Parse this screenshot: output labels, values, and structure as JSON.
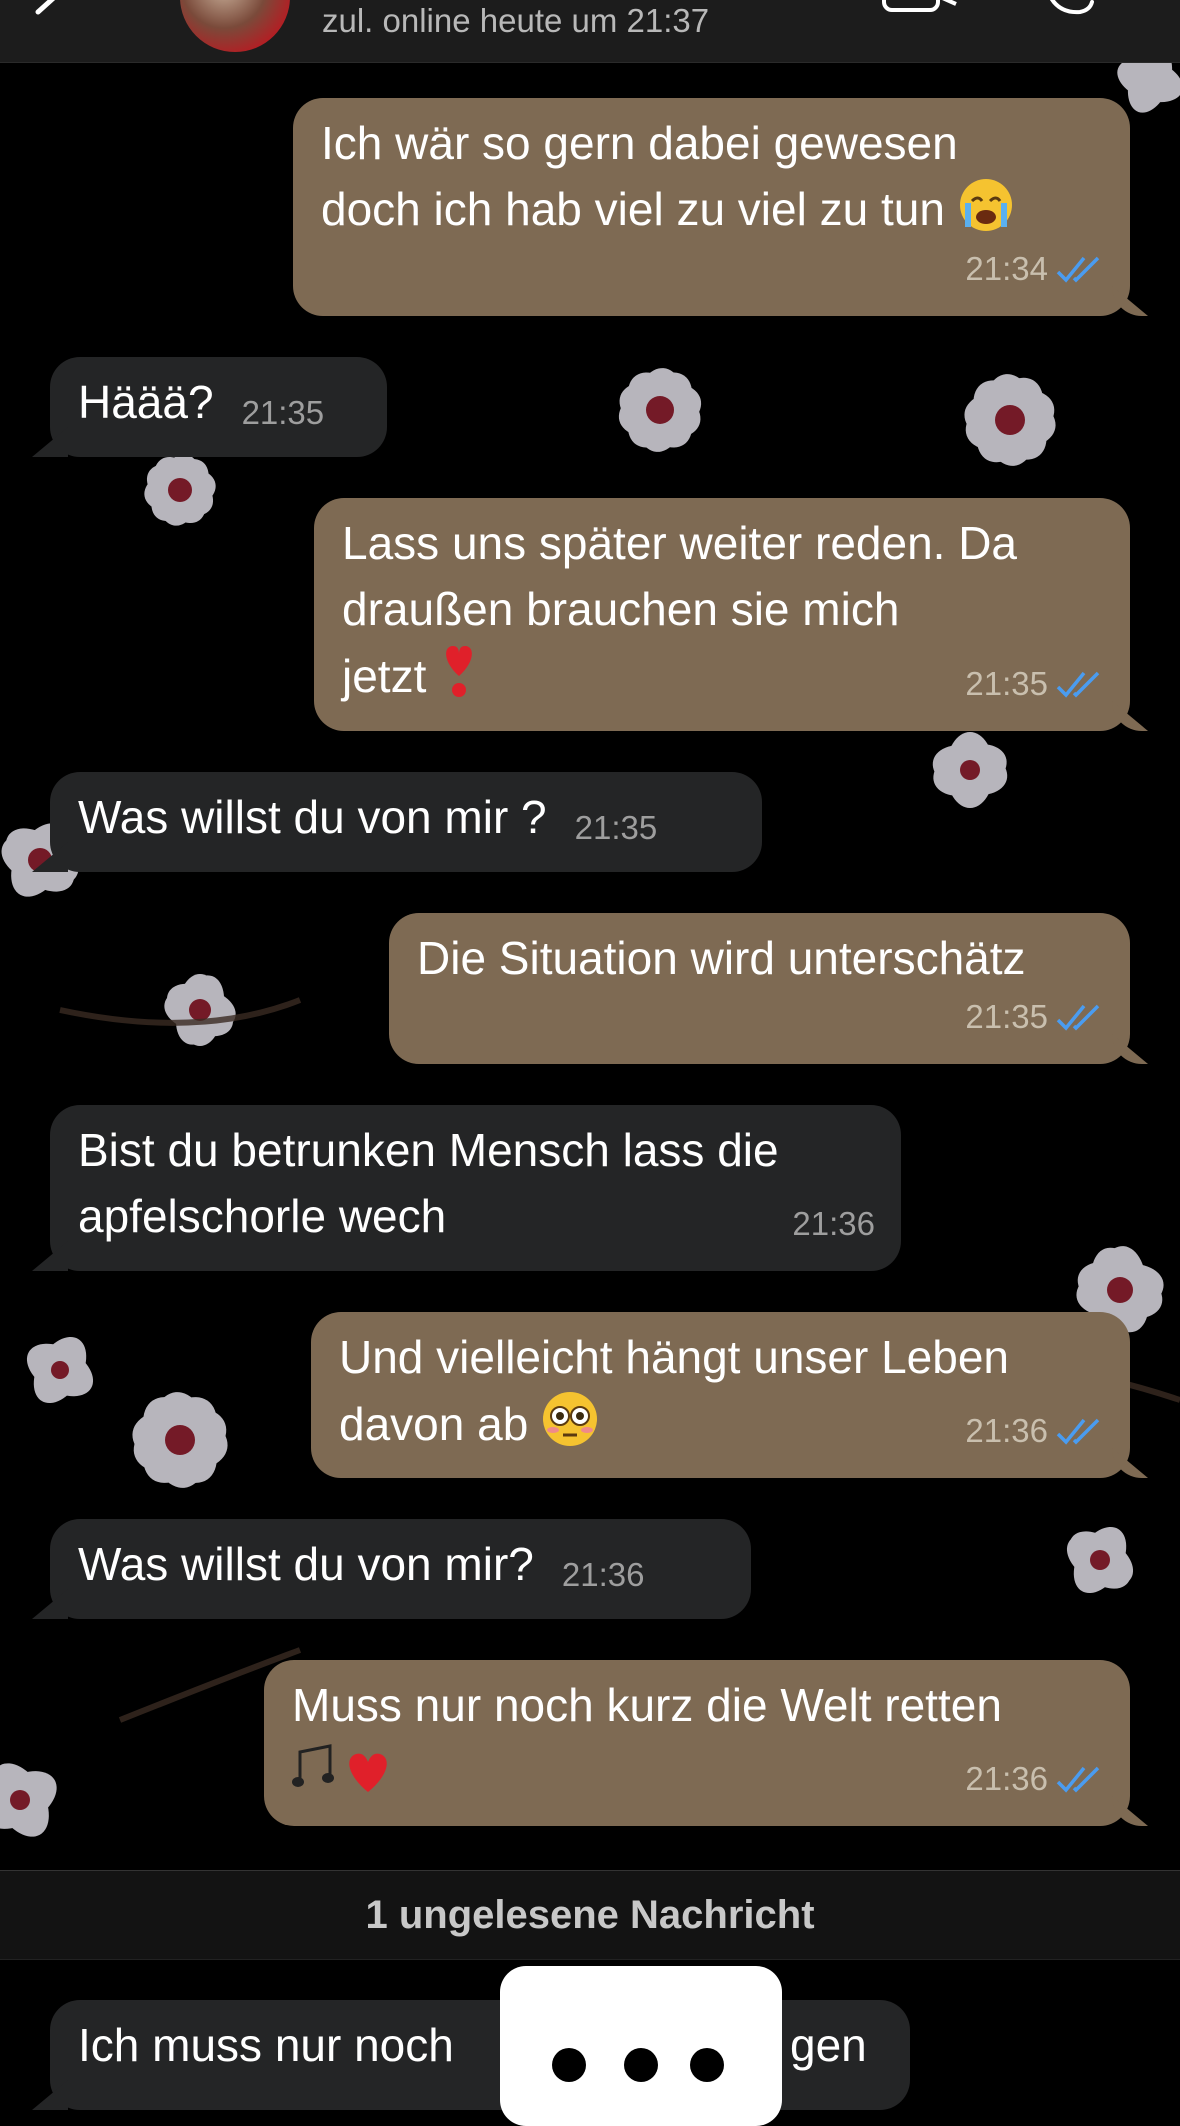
{
  "header": {
    "status": "zul. online heute um 21:37"
  },
  "messages": [
    {
      "dir": "out",
      "text": "Ich wär so gern dabei gewesen\ndoch ich hab viel zu viel zu tun ",
      "emoji": "crying-face",
      "time": "21:34"
    },
    {
      "dir": "in",
      "text": "Häää?",
      "time": "21:35"
    },
    {
      "dir": "out",
      "text": "Lass uns später weiter reden. Da\ndraußen brauchen sie mich\njetzt ",
      "emoji": "heart-exclamation",
      "time": "21:35"
    },
    {
      "dir": "in",
      "text": "Was willst du von mir ?",
      "time": "21:35"
    },
    {
      "dir": "out",
      "text": "Die Situation wird unterschätz",
      "time": "21:35"
    },
    {
      "dir": "in",
      "text": "Bist du betrunken Mensch lass die\napfelschorle wech",
      "time": "21:36"
    },
    {
      "dir": "out",
      "text": "Und vielleicht hängt unser Leben\ndavon ab ",
      "emoji": "flushed-face",
      "time": "21:36"
    },
    {
      "dir": "in",
      "text": "Was willst du von mir?",
      "time": "21:36"
    },
    {
      "dir": "out",
      "text": "Muss nur noch kurz die Welt retten\n",
      "emoji": "music-notes-heart",
      "time": "21:36"
    }
  ],
  "unread": "1 ungelesene Nachricht",
  "last_message": {
    "text_left": "Ich muss nur noch",
    "text_right": "gen"
  },
  "colors": {
    "outgoing_bubble": "#7e6a53",
    "incoming_bubble": "#242526",
    "read_ticks": "#4a9cf0"
  }
}
